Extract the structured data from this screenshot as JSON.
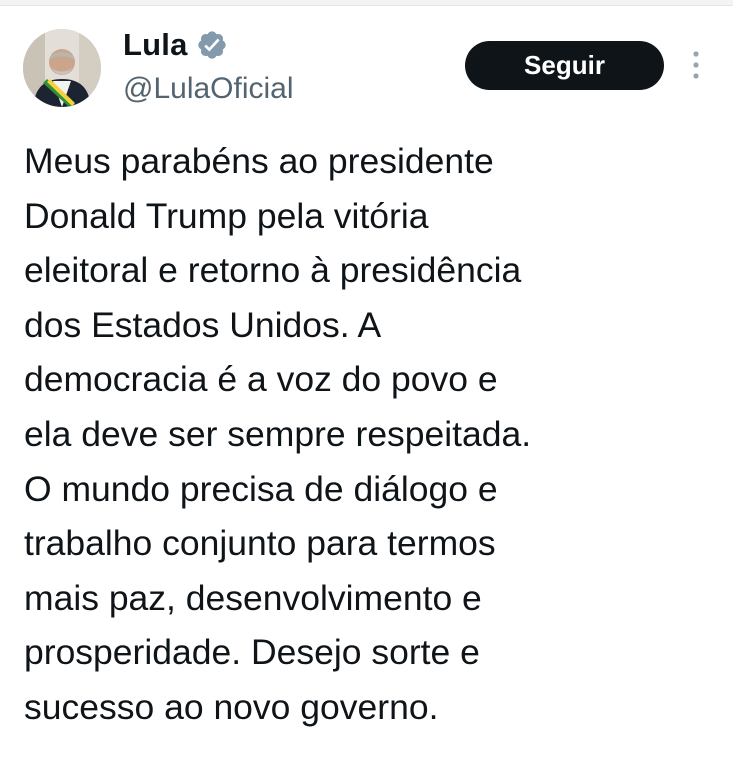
{
  "author": {
    "display_name": "Lula",
    "handle": "@LulaOficial",
    "verified_icon": "verified-badge-icon",
    "avatar": "avatar-photo"
  },
  "actions": {
    "follow_label": "Seguir",
    "more_icon": "more-options-icon"
  },
  "tweet": {
    "lines": [
      "Meus parabéns ao presidente",
      "Donald Trump pela vitória",
      "eleitoral e retorno à presidência",
      "dos Estados Unidos. A",
      "democracia é a voz do povo e",
      "ela deve ser sempre respeitada.",
      "O mundo precisa de diálogo e",
      "trabalho conjunto para termos",
      "mais paz, desenvolvimento e",
      "prosperidade. Desejo sorte e",
      "sucesso ao novo governo."
    ]
  },
  "colors": {
    "text": "#0f1419",
    "secondary_text": "#536471",
    "follow_button_bg": "#0f1419",
    "follow_button_text": "#ffffff",
    "verified_badge": "#829aab"
  }
}
